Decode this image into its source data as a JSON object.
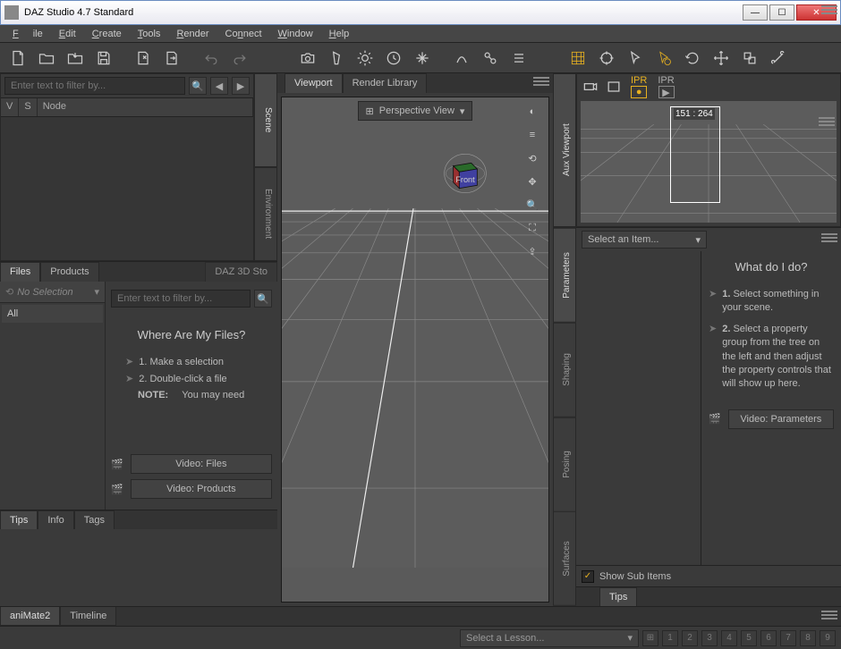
{
  "window": {
    "title": "DAZ Studio 4.7 Standard"
  },
  "menu": {
    "file": "File",
    "edit": "Edit",
    "create": "Create",
    "tools": "Tools",
    "render": "Render",
    "connect": "Connect",
    "window": "Window",
    "help": "Help"
  },
  "scene": {
    "filter_placeholder": "Enter text to filter by...",
    "cols": {
      "v": "V",
      "s": "S",
      "node": "Node"
    },
    "tabs": {
      "scene": "Scene",
      "environment": "Environment"
    }
  },
  "content": {
    "tabs": {
      "files": "Files",
      "products": "Products",
      "daz3d": "DAZ 3D Sto"
    },
    "nav": {
      "nosel": "No Selection",
      "all": "All"
    },
    "filter_placeholder": "Enter text to filter by...",
    "heading": "Where Are My Files?",
    "step1": "1. Make a selection",
    "step2": "2. Double-click a file",
    "note_label": "NOTE:",
    "note_text": "You may need",
    "vid_files": "Video:  Files",
    "vid_products": "Video:  Products",
    "bottom_tabs": {
      "tips": "Tips",
      "info": "Info",
      "tags": "Tags"
    }
  },
  "viewport": {
    "tabs": {
      "viewport": "Viewport",
      "renderlib": "Render Library"
    },
    "view_label": "Perspective View"
  },
  "aux": {
    "tab": "Aux Viewport",
    "ipr1": "IPR",
    "ipr2": "IPR",
    "coords": "151 : 264"
  },
  "params": {
    "select_item": "Select an Item...",
    "tabs": {
      "parameters": "Parameters",
      "shaping": "Shaping",
      "posing": "Posing",
      "surfaces": "Surfaces"
    },
    "heading": "What do I do?",
    "step1_a": "1.",
    "step1_b": "Select something in your scene.",
    "step2_a": "2.",
    "step2_b": "Select a property group from the tree on the left and then adjust the property controls that will show up here.",
    "vid": "Video:  Parameters",
    "show_sub": "Show Sub Items",
    "bottom_tab": "Tips"
  },
  "bottom": {
    "animate": "aniMate2",
    "timeline": "Timeline",
    "lesson": "Select a Lesson...",
    "nums": [
      "1",
      "2",
      "3",
      "4",
      "5",
      "6",
      "7",
      "8",
      "9"
    ]
  }
}
